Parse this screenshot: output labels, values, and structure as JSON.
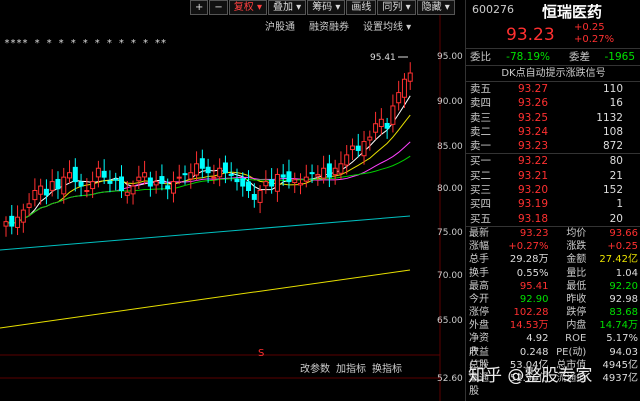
{
  "toolbar": {
    "items": [
      "+",
      "−",
      "复权 ▾",
      "叠加 ▾",
      "筹码 ▾",
      "画线",
      "同列 ▾",
      "隐藏 ▾"
    ]
  },
  "subbar": {
    "items": [
      "沪股通",
      "融资融券",
      "设置均线 ▾"
    ]
  },
  "bottombar": {
    "items": [
      "改参数",
      "加指标",
      "换指标"
    ]
  },
  "chart": {
    "axis_labels": [
      "95.00",
      "90.00",
      "85.00",
      "80.00",
      "75.00",
      "70.00",
      "65.00",
      "52.60"
    ],
    "high_label": "95.41",
    "stars": "****    *     *    *    *  *  *    *     *    *    *     **",
    "marker": "S"
  },
  "header": {
    "code": "600276",
    "name": "恒瑞医药",
    "price": "93.23",
    "change": "+0.25",
    "change_pct": "+0.27%"
  },
  "ratio": {
    "label1": "委比",
    "value1": "-78.19%",
    "label2": "委差",
    "value2": "-1965"
  },
  "signal": "DK点自动提示涨跌信号",
  "sell": [
    {
      "label": "卖五",
      "price": "93.27",
      "vol": "110"
    },
    {
      "label": "卖四",
      "price": "93.26",
      "vol": "16"
    },
    {
      "label": "卖三",
      "price": "93.25",
      "vol": "1132"
    },
    {
      "label": "卖二",
      "price": "93.24",
      "vol": "108"
    },
    {
      "label": "卖一",
      "price": "93.23",
      "vol": "872"
    }
  ],
  "buy": [
    {
      "label": "买一",
      "price": "93.22",
      "vol": "80"
    },
    {
      "label": "买二",
      "price": "93.21",
      "vol": "21"
    },
    {
      "label": "买三",
      "price": "93.20",
      "vol": "152"
    },
    {
      "label": "买四",
      "price": "93.19",
      "vol": "1"
    },
    {
      "label": "买五",
      "price": "93.18",
      "vol": "20"
    }
  ],
  "stats": [
    {
      "l1": "最新",
      "v1": "93.23",
      "c1": "red",
      "l2": "均价",
      "v2": "93.66",
      "c2": "red"
    },
    {
      "l1": "涨幅",
      "v1": "+0.27%",
      "c1": "red",
      "l2": "涨跌",
      "v2": "+0.25",
      "c2": "red"
    },
    {
      "l1": "总手",
      "v1": "29.28万",
      "c1": "white",
      "l2": "金额",
      "v2": "27.42亿",
      "c2": "yellow"
    },
    {
      "l1": "换手",
      "v1": "0.55%",
      "c1": "white",
      "l2": "量比",
      "v2": "1.04",
      "c2": "white"
    },
    {
      "l1": "最高",
      "v1": "95.41",
      "c1": "red",
      "l2": "最低",
      "v2": "92.20",
      "c2": "green"
    },
    {
      "l1": "今开",
      "v1": "92.90",
      "c1": "green",
      "l2": "昨收",
      "v2": "92.98",
      "c2": "white"
    },
    {
      "l1": "涨停",
      "v1": "102.28",
      "c1": "red",
      "l2": "跌停",
      "v2": "83.68",
      "c2": "green"
    },
    {
      "l1": "外盘",
      "v1": "14.53万",
      "c1": "red",
      "l2": "内盘",
      "v2": "14.74万",
      "c2": "green"
    },
    {
      "l1": "净资产",
      "v1": "4.92",
      "c1": "white",
      "l2": "ROE",
      "v2": "5.17%",
      "c2": "white"
    },
    {
      "l1": "收益(二)",
      "v1": "0.248",
      "c1": "white",
      "l2": "PE(动)",
      "v2": "94.03",
      "c2": "white"
    },
    {
      "l1": "总股本",
      "v1": "53.04亿",
      "c1": "white",
      "l2": "总市值",
      "v2": "4945亿",
      "c2": "white"
    },
    {
      "l1": "流通股",
      "v1": "52.96亿",
      "c1": "white",
      "l2": "流通值",
      "v2": "4937亿",
      "c2": "white"
    }
  ],
  "watermark": "知乎 @整股专家"
}
